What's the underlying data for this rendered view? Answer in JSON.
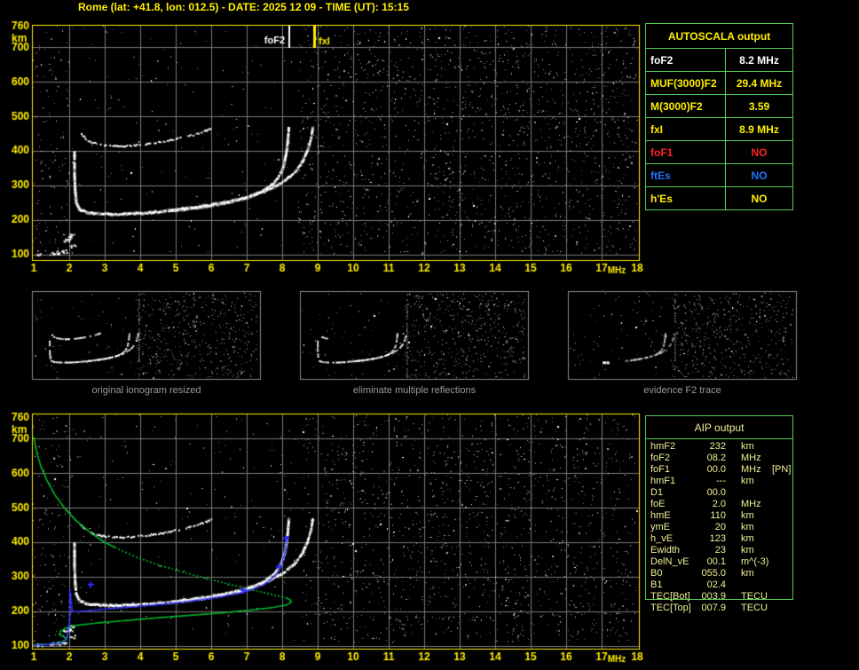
{
  "title": "Rome (lat: +41.8, lon: 012.5) - DATE: 2025 12 09 - TIME (UT): 15:15",
  "colors": {
    "axis": "#ffee00",
    "grid": "#7a7a7a",
    "table_border": "#55cc55",
    "caption": "#9a9a9a",
    "aip_text": "#f0f096",
    "profile_green": "#00cc33",
    "restored_blue": "#2a2aff",
    "trace_white": "#ffffff",
    "marker_fof2": "#ffffff",
    "marker_fxi": "#ffee00"
  },
  "autoscala_table": {
    "header": "AUTOSCALA output",
    "rows": [
      {
        "label": "foF2",
        "value": "8.2 MHz",
        "color": "#ffffff"
      },
      {
        "label": "MUF(3000)F2",
        "value": "29.4 MHz",
        "color": "#ffee00"
      },
      {
        "label": "M(3000)F2",
        "value": "3.59",
        "color": "#ffee00"
      },
      {
        "label": "fxI",
        "value": "8.9 MHz",
        "color": "#ffee00"
      },
      {
        "label": "foF1",
        "value": "NO",
        "color": "#ff2222"
      },
      {
        "label": "ftEs",
        "value": "NO",
        "color": "#2470ff"
      },
      {
        "label": "h'Es",
        "value": "NO",
        "color": "#ffee00"
      }
    ]
  },
  "aip_table": {
    "header": "AIP output",
    "rows": [
      {
        "label": "hmF2",
        "value": "232",
        "unit": "km",
        "note": ""
      },
      {
        "label": "foF2",
        "value": "08.2",
        "unit": "MHz",
        "note": ""
      },
      {
        "label": "foF1",
        "value": "00.0",
        "unit": "MHz",
        "note": "[PN]"
      },
      {
        "label": "hmF1",
        "value": "---",
        "unit": "km",
        "note": ""
      },
      {
        "label": "D1",
        "value": "00.0",
        "unit": "",
        "note": ""
      },
      {
        "label": "foE",
        "value": "2.0",
        "unit": "MHz",
        "note": ""
      },
      {
        "label": "hmE",
        "value": "110",
        "unit": "km",
        "note": ""
      },
      {
        "label": "ymE",
        "value": "20",
        "unit": "km",
        "note": ""
      },
      {
        "label": "h_vE",
        "value": "123",
        "unit": "km",
        "note": ""
      },
      {
        "label": "Ewidth",
        "value": "23",
        "unit": "km",
        "note": ""
      },
      {
        "label": "DelN_vE",
        "value": "00.1",
        "unit": "m^(-3)",
        "note": ""
      },
      {
        "label": "B0",
        "value": "055.0",
        "unit": "km",
        "note": ""
      },
      {
        "label": "B1",
        "value": "02.4",
        "unit": "",
        "note": ""
      },
      {
        "label": "TEC[Bot]",
        "value": "003.9",
        "unit": "TECU",
        "note": ""
      },
      {
        "label": "TEC[Top]",
        "value": "007.9",
        "unit": "TECU",
        "note": ""
      }
    ]
  },
  "thumbnails": [
    {
      "caption": "original ionogram resized"
    },
    {
      "caption": "eliminate multiple reflections"
    },
    {
      "caption": "evidence F2 trace"
    }
  ],
  "chart_data": [
    {
      "type": "scatter",
      "title": "scaled ionogram (virtual height vs frequency)",
      "x": {
        "label": "MHz",
        "min": 1,
        "max": 18,
        "ticks": [
          1,
          2,
          3,
          4,
          5,
          6,
          7,
          8,
          9,
          10,
          11,
          12,
          13,
          14,
          15,
          16,
          17,
          18
        ]
      },
      "y": {
        "label": "km",
        "min": 100,
        "max": 760,
        "ticks": [
          760,
          700,
          600,
          500,
          400,
          300,
          200,
          100
        ]
      },
      "grid": true,
      "markers": [
        {
          "label": "foF2",
          "freq_mhz": 8.2,
          "color": "#ffffff"
        },
        {
          "label": "fxI",
          "freq_mhz": 8.9,
          "color": "#ffee00"
        }
      ],
      "series": {
        "o_trace": [
          [
            2.15,
            395
          ],
          [
            2.15,
            330
          ],
          [
            2.17,
            285
          ],
          [
            2.2,
            250
          ],
          [
            2.3,
            230
          ],
          [
            2.5,
            222
          ],
          [
            2.8,
            219
          ],
          [
            3.2,
            217
          ],
          [
            3.7,
            218
          ],
          [
            4.2,
            221
          ],
          [
            4.7,
            226
          ],
          [
            5.2,
            231
          ],
          [
            5.7,
            237
          ],
          [
            6.1,
            244
          ],
          [
            6.5,
            252
          ],
          [
            6.9,
            262
          ],
          [
            7.25,
            274
          ],
          [
            7.55,
            290
          ],
          [
            7.8,
            310
          ],
          [
            7.95,
            332
          ],
          [
            8.05,
            360
          ],
          [
            8.12,
            395
          ],
          [
            8.16,
            430
          ],
          [
            8.19,
            470
          ]
        ],
        "x_trace": [
          [
            5.15,
            232
          ],
          [
            5.6,
            238
          ],
          [
            6.0,
            244
          ],
          [
            6.4,
            251
          ],
          [
            6.8,
            260
          ],
          [
            7.15,
            270
          ],
          [
            7.5,
            283
          ],
          [
            7.85,
            300
          ],
          [
            8.15,
            320
          ],
          [
            8.4,
            343
          ],
          [
            8.58,
            370
          ],
          [
            8.72,
            402
          ],
          [
            8.82,
            438
          ],
          [
            8.87,
            472
          ]
        ],
        "multiple_reflection_trace": [
          [
            2.35,
            448
          ],
          [
            2.5,
            432
          ],
          [
            2.7,
            423
          ],
          [
            3.0,
            417
          ],
          [
            3.35,
            414
          ],
          [
            3.75,
            415
          ],
          [
            4.2,
            420
          ],
          [
            4.65,
            427
          ],
          [
            5.1,
            436
          ],
          [
            5.5,
            446
          ],
          [
            5.85,
            458
          ],
          [
            6.05,
            468
          ]
        ],
        "e_region_patches": [
          [
            1.5,
            107
          ],
          [
            1.7,
            109
          ],
          [
            1.85,
            112
          ],
          [
            2.0,
            150
          ],
          [
            1.9,
            143
          ],
          [
            2.05,
            158
          ],
          [
            1.15,
            104
          ],
          [
            2.1,
            128
          ]
        ]
      }
    },
    {
      "type": "scatter",
      "title": "ionogram with restored trace and electron density profile",
      "x": {
        "label": "MHz",
        "min": 1,
        "max": 18,
        "ticks": [
          1,
          2,
          3,
          4,
          5,
          6,
          7,
          8,
          9,
          10,
          11,
          12,
          13,
          14,
          15,
          16,
          17,
          18
        ]
      },
      "y": {
        "label": "km",
        "min": 100,
        "max": 760,
        "ticks": [
          760,
          700,
          600,
          500,
          400,
          300,
          200,
          100
        ]
      },
      "grid": true,
      "series": {
        "profile_solid_upper": [
          [
            1.0,
            703
          ],
          [
            1.08,
            662
          ],
          [
            1.2,
            620
          ],
          [
            1.38,
            578
          ],
          [
            1.6,
            537
          ],
          [
            1.88,
            498
          ],
          [
            2.2,
            462
          ],
          [
            2.6,
            428
          ],
          [
            3.0,
            400
          ],
          [
            3.3,
            385
          ]
        ],
        "profile_dotted_mid": [
          [
            3.3,
            385
          ],
          [
            3.9,
            357
          ],
          [
            4.6,
            332
          ],
          [
            5.3,
            311
          ],
          [
            6.0,
            292
          ],
          [
            6.7,
            274
          ],
          [
            7.3,
            259
          ],
          [
            7.8,
            247
          ],
          [
            8.1,
            240
          ]
        ],
        "profile_solid_lower": [
          [
            8.1,
            240
          ],
          [
            8.22,
            234
          ],
          [
            8.25,
            227
          ],
          [
            8.12,
            219
          ],
          [
            7.7,
            211
          ],
          [
            7.1,
            204
          ],
          [
            6.3,
            196
          ],
          [
            5.4,
            189
          ],
          [
            4.5,
            182
          ],
          [
            3.6,
            174
          ],
          [
            2.8,
            167
          ],
          [
            2.2,
            160
          ],
          [
            1.9,
            152
          ],
          [
            1.76,
            143
          ],
          [
            1.73,
            134
          ],
          [
            1.82,
            128
          ],
          [
            1.92,
            122
          ],
          [
            1.87,
            115
          ],
          [
            1.72,
            110
          ],
          [
            1.45,
            106
          ],
          [
            1.15,
            104
          ],
          [
            1.0,
            103
          ]
        ],
        "restored_trace_blue": [
          [
            1.0,
            103
          ],
          [
            1.3,
            104
          ],
          [
            1.6,
            107
          ],
          [
            1.8,
            110
          ],
          [
            1.92,
            120
          ],
          [
            1.98,
            145
          ],
          [
            2.0,
            170
          ],
          [
            2.03,
            195
          ],
          [
            2.02,
            230
          ],
          [
            2.02,
            262
          ],
          [
            2.05,
            240
          ],
          [
            2.08,
            205
          ],
          [
            2.15,
            200
          ],
          [
            2.35,
            200
          ],
          [
            2.6,
            203
          ],
          [
            3.0,
            207
          ],
          [
            3.5,
            211
          ],
          [
            4.0,
            215
          ],
          [
            4.5,
            220
          ],
          [
            5.0,
            225
          ],
          [
            5.5,
            231
          ],
          [
            6.0,
            238
          ],
          [
            6.4,
            245
          ],
          [
            6.8,
            253
          ],
          [
            7.15,
            263
          ],
          [
            7.45,
            276
          ],
          [
            7.7,
            293
          ],
          [
            7.88,
            315
          ],
          [
            8.0,
            342
          ],
          [
            8.08,
            372
          ],
          [
            8.13,
            402
          ],
          [
            8.15,
            422
          ]
        ]
      }
    }
  ]
}
